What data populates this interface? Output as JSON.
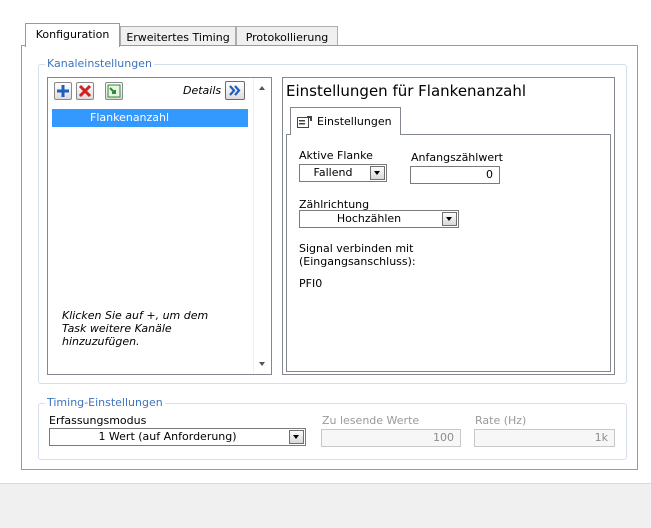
{
  "tabs": [
    "Konfiguration",
    "Erweitertes Timing",
    "Protokollierung"
  ],
  "channel_settings": {
    "legend": "Kanaleinstellungen",
    "details_label": "Details",
    "details_button": "»",
    "items": [
      "Flankenanzahl"
    ],
    "hint": "Klicken Sie auf +, um dem Task weitere Kanäle hinzuzufügen.",
    "toolbar_icons": [
      "add-icon",
      "remove-icon",
      "channel-edit-icon"
    ]
  },
  "settings_panel": {
    "title": "Einstellungen für Flankenanzahl",
    "tab_label": "Einstellungen",
    "active_edge_label": "Aktive Flanke",
    "active_edge_value": "Fallend",
    "initial_count_label": "Anfangszählwert",
    "initial_count_value": "0",
    "count_direction_label": "Zählrichtung",
    "count_direction_value": "Hochzählen",
    "signal_label": "Signal verbinden mit\n(Eingangsanschluss):",
    "signal_value": "PFI0"
  },
  "timing": {
    "legend": "Timing-Einstellungen",
    "mode_label": "Erfassungsmodus",
    "mode_value": "1 Wert (auf Anforderung)",
    "samples_label": "Zu lesende Werte",
    "samples_value": "100",
    "rate_label": "Rate (Hz)",
    "rate_value": "1k"
  },
  "colors": {
    "accent": "#3c74c0",
    "selection": "#3399ff",
    "add_icon": "#1f5fbf",
    "remove_icon": "#d21f1f",
    "edit_icon": "#2e8b2e"
  }
}
